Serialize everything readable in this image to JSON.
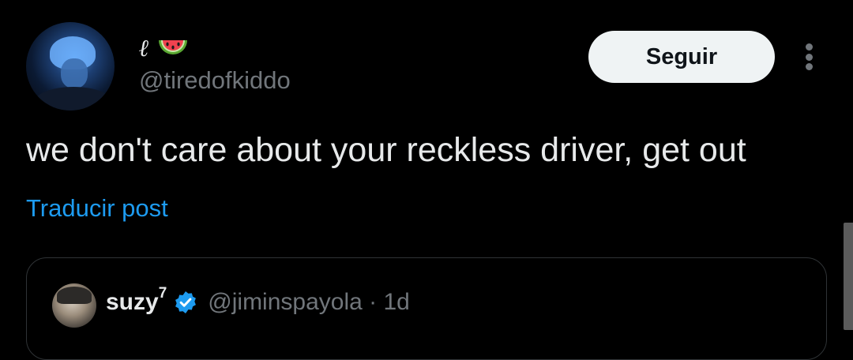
{
  "author": {
    "display_name": "ℓ",
    "name_emoji": "watermelon-icon",
    "handle": "@tiredofkiddo"
  },
  "actions": {
    "follow_label": "Seguir",
    "more_icon": "more-vertical-icon"
  },
  "post": {
    "text": "we don't care about your reckless driver, get out",
    "translate_label": "Traducir post"
  },
  "quoted_post": {
    "display_name": "suzy",
    "name_superscript": "7",
    "verified_icon": "verified-badge-icon",
    "handle": "@jiminspayola",
    "separator": "·",
    "time": "1d"
  },
  "colors": {
    "background": "#000000",
    "text_primary": "#e7e9ea",
    "text_secondary": "#71767b",
    "link": "#1d9bf0",
    "follow_button_bg": "#eff3f4",
    "border": "#2f3336"
  }
}
